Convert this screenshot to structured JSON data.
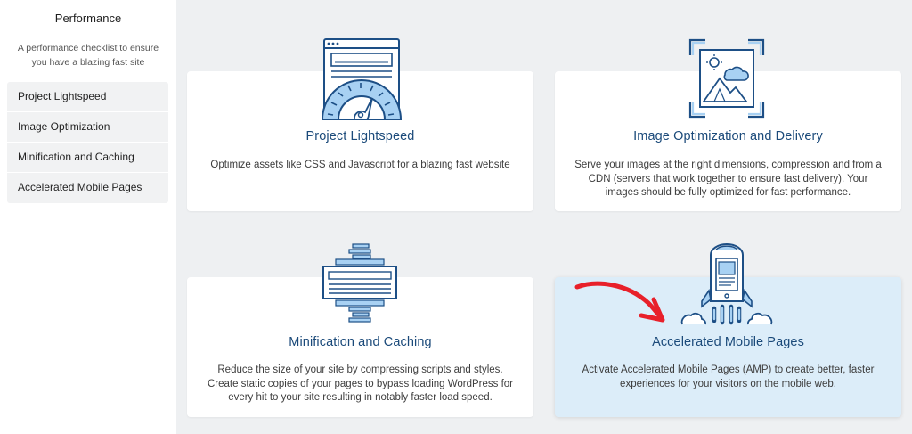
{
  "sidebar": {
    "title": "Performance",
    "description": "A performance checklist to ensure you have a blazing fast site",
    "items": [
      {
        "label": "Project Lightspeed"
      },
      {
        "label": "Image Optimization"
      },
      {
        "label": "Minification and Caching"
      },
      {
        "label": "Accelerated Mobile Pages"
      }
    ]
  },
  "cards": [
    {
      "title": "Project Lightspeed",
      "description": "Optimize assets like CSS and Javascript for a blazing fast website",
      "icon": "speedometer-browser-icon"
    },
    {
      "title": "Image Optimization and Delivery",
      "description": "Serve your images at the right dimensions, compression and from a CDN (servers that work together to ensure fast delivery). Your images should be fully optimized for fast performance.",
      "icon": "image-frame-icon"
    },
    {
      "title": "Minification and Caching",
      "description": "Reduce the size of your site by compressing scripts and styles. Create static copies of your pages to bypass loading WordPress for every hit to your site resulting in notably faster load speed.",
      "icon": "compress-stack-icon"
    },
    {
      "title": "Accelerated Mobile Pages",
      "description": "Activate Accelerated Mobile Pages (AMP) to create better, faster experiences for your visitors on the mobile web.",
      "icon": "rocket-phone-icon",
      "highlighted": true
    }
  ],
  "annotation": {
    "icon": "red-arrow-icon",
    "color": "#e8202a"
  },
  "colors": {
    "accent_dark": "#1b4a7a",
    "icon_stroke": "#1d4f86",
    "icon_fill": "#a8d1f3",
    "highlight_bg": "#dcedf9",
    "main_bg": "#eef0f2"
  }
}
